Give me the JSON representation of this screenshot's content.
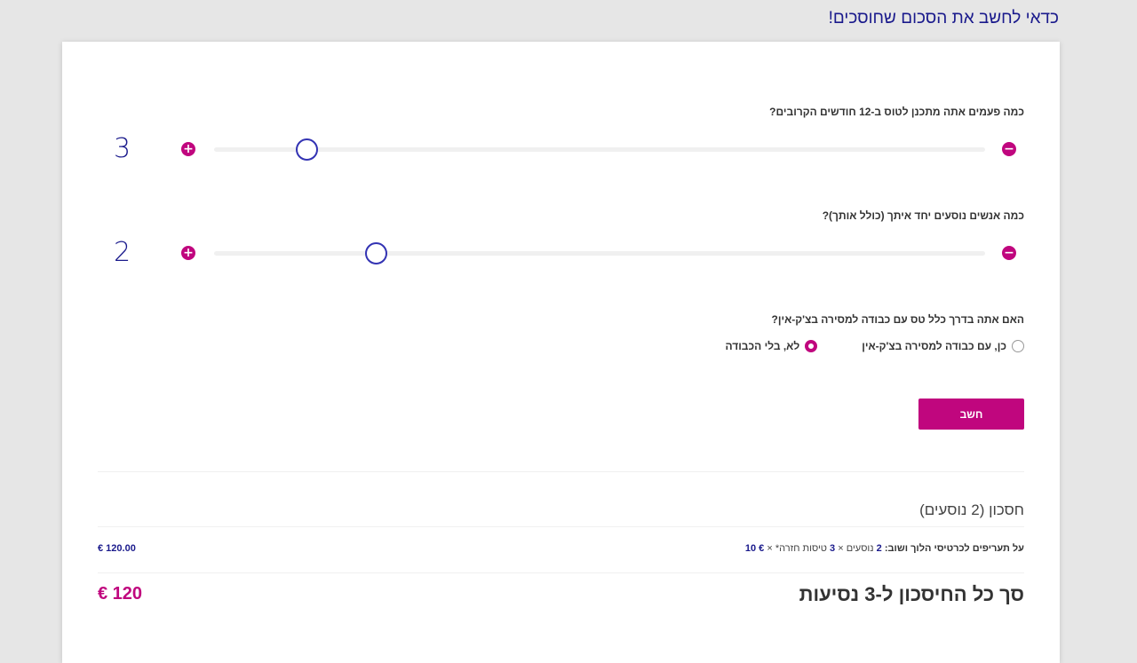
{
  "page": {
    "heading": "כדאי לחשב את הסכום שחוסכים!"
  },
  "calculator": {
    "flights_question": "כמה פעמים אתה מתכנן לטוס ב-12 חודשים הקרובים?",
    "flights_value": "3",
    "flights_level": 0.88,
    "passengers_question": "כמה אנשים נוסעים יחד איתך (כולל אותך)?",
    "passengers_value": "2",
    "passengers_level": 0.79,
    "luggage_question": "האם אתה בדרך כלל טס עם כבודה למסירה בצ'ק-אין?",
    "luggage_options": [
      "כן, עם כבודה למסירה בצ'ק-אין",
      "לא, בלי הכבודה"
    ],
    "luggage_selected": 1,
    "calculate_label": "חשב"
  },
  "results": {
    "savings_heading": "חסכון (2 נוסעים)",
    "breakdown_label": "על תעריפים לכרטיסי הלוך ושוב:",
    "breakdown_passengers": "2",
    "breakdown_passengers_text": "נוסעים ×",
    "breakdown_flights": "3",
    "breakdown_flights_text": "טיסות חזרה* ×",
    "breakdown_fee": "€ 10",
    "breakdown_amount": "€ 120.00",
    "total_label": "סך כל החיסכון ל-3 נסיעות",
    "total_amount": "€ 120"
  },
  "colors": {
    "accent": "#c0067e",
    "primary": "#1a1a8c"
  },
  "icons": {
    "plus": "plus-circle-icon",
    "minus": "minus-circle-icon"
  }
}
